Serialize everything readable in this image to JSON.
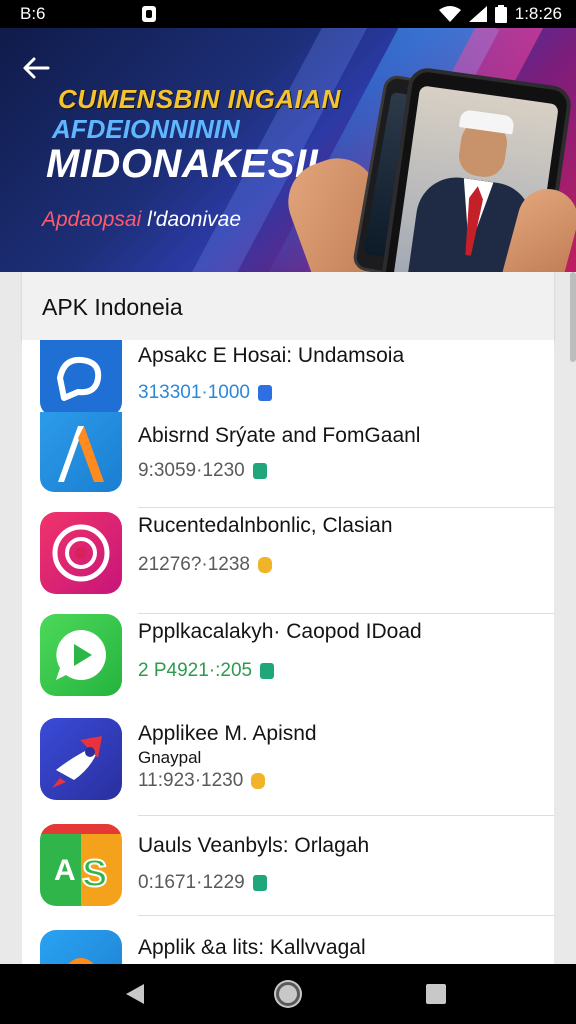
{
  "status_bar": {
    "time_left": "B:6",
    "time_right": "1:8:26"
  },
  "banner": {
    "line1": "CUMENSBIN INGAIAN",
    "line2": "AFDEIONNININ",
    "line3": "MIDONAKESII",
    "subtitle_accent": "Apdaopsai",
    "subtitle_rest": " l'daonivae"
  },
  "section": {
    "title": "APK Indoneia"
  },
  "apps": [
    {
      "name": "Apsakc E Hosai: Undamsoia",
      "meta": "313301·1000",
      "meta_color": "#2a88d8",
      "badge_color": "#2f6fe4"
    },
    {
      "name": "Abisrnd Srýate and FomGaanl",
      "meta": "9:3059·1230",
      "meta_color": "#5a5a5a",
      "badge_color": "#1fa67a"
    },
    {
      "name": "Rucentedalnbonlic, Clasian",
      "meta": "21276?·1238",
      "meta_color": "#5a5a5a",
      "badge_color": "#f0b429"
    },
    {
      "name": "Ppplkacalakyh· Caopod IDoad",
      "meta": "2 P4921·:205",
      "meta_color": "#2e9a4e",
      "badge_color": "#1fa67a"
    },
    {
      "name": "Applikee M. Apisnd",
      "name2": "Gnaypal",
      "meta": "11:923·1230",
      "meta_color": "#5a5a5a",
      "badge_color": "#f0b429"
    },
    {
      "name": "Uauls Veanbyls: Orlagah",
      "meta": "0:1671·1229",
      "meta_color": "#5a5a5a",
      "badge_color": "#1fa67a"
    },
    {
      "name": "Applik &a lits: Kallvvagal",
      "meta": "",
      "meta_color": "#5a5a5a",
      "badge_color": "#1fa67a"
    }
  ],
  "icons": [
    "send-app-icon",
    "a-letter-app-icon",
    "camera-lens-app-icon",
    "chat-bubble-app-icon",
    "rocket-app-icon",
    "as-letters-app-icon",
    "orange-app-icon"
  ]
}
